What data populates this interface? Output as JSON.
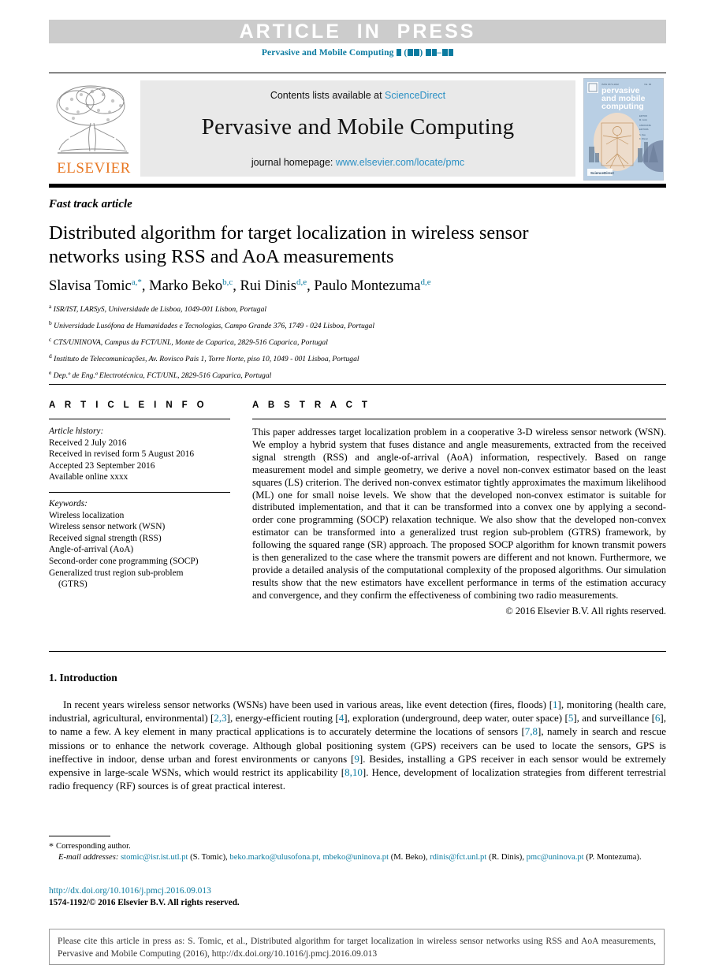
{
  "banner": {
    "article_in_press": "ARTICLE  IN  PRESS",
    "journal_ref_prefix": "Pervasive and Mobile Computing"
  },
  "masthead": {
    "contents_prefix": "Contents lists available at ",
    "sciencedirect": "ScienceDirect",
    "journal_name": "Pervasive and Mobile Computing",
    "homepage_prefix": "journal homepage: ",
    "homepage_url": "www.elsevier.com/locate/pmc",
    "publisher": "ELSEVIER",
    "cover_title_line1": "pervasive",
    "cover_title_line2": "and mobile",
    "cover_title_line3": "computing"
  },
  "article": {
    "type_label": "Fast track article",
    "title": "Distributed algorithm for target localization in wireless sensor networks using RSS and AoA measurements",
    "authors": [
      {
        "name": "Slavisa Tomic",
        "sup": "a,*"
      },
      {
        "name": "Marko Beko",
        "sup": "b,c"
      },
      {
        "name": "Rui Dinis",
        "sup": "d,e"
      },
      {
        "name": "Paulo Montezuma",
        "sup": "d,e"
      }
    ],
    "affiliations": [
      {
        "mark": "a",
        "text": "ISR/IST, LARSyS, Universidade de Lisboa, 1049-001 Lisbon, Portugal"
      },
      {
        "mark": "b",
        "text": "Universidade Lusófona de Humanidades e Tecnologias, Campo Grande 376, 1749 - 024 Lisboa, Portugal"
      },
      {
        "mark": "c",
        "text": "CTS/UNINOVA, Campus da FCT/UNL, Monte de Caparica, 2829-516 Caparica, Portugal"
      },
      {
        "mark": "d",
        "text": "Instituto de Telecomunicações, Av. Rovisco Pais 1, Torre Norte, piso 10, 1049 - 001 Lisboa, Portugal"
      },
      {
        "mark": "e",
        "text": "Dep.º de Eng.ª Electrotécnica, FCT/UNL, 2829-516 Caparica, Portugal"
      }
    ]
  },
  "info": {
    "heading": "A R T I C L E   I N F O",
    "history_label": "Article history:",
    "history": [
      "Received 2 July 2016",
      "Received in revised form 5 August 2016",
      "Accepted 23 September 2016",
      "Available online xxxx"
    ],
    "keywords_label": "Keywords:",
    "keywords": [
      "Wireless localization",
      "Wireless sensor network (WSN)",
      "Received signal strength (RSS)",
      "Angle-of-arrival (AoA)",
      "Second-order cone programming (SOCP)",
      "Generalized trust region sub-problem",
      "(GTRS)"
    ]
  },
  "abstract": {
    "heading": "A B S T R A C T",
    "body": "This paper addresses target localization problem in a cooperative 3-D wireless sensor network (WSN). We employ a hybrid system that fuses distance and angle measurements, extracted from the received signal strength (RSS) and angle-of-arrival (AoA) information, respectively. Based on range measurement model and simple geometry, we derive a novel non-convex estimator based on the least squares (LS) criterion. The derived non-convex estimator tightly approximates the maximum likelihood (ML) one for small noise levels. We show that the developed non-convex estimator is suitable for distributed implementation, and that it can be transformed into a convex one by applying a second-order cone programming (SOCP) relaxation technique. We also show that the developed non-convex estimator can be transformed into a generalized trust region sub-problem (GTRS) framework, by following the squared range (SR) approach. The proposed SOCP algorithm for known transmit powers is then generalized to the case where the transmit powers are different and not known. Furthermore, we provide a detailed analysis of the computational complexity of the proposed algorithms. Our simulation results show that the new estimators have excellent performance in terms of the estimation accuracy and convergence, and they confirm the effectiveness of combining two radio measurements.",
    "copyright": "© 2016 Elsevier B.V. All rights reserved."
  },
  "introduction": {
    "heading": "1. Introduction",
    "paragraph_parts": [
      {
        "t": "In recent years wireless sensor networks (WSNs) have been used in various areas, like event detection (fires, floods) ["
      },
      {
        "r": "1"
      },
      {
        "t": "], monitoring (health care, industrial, agricultural, environmental) ["
      },
      {
        "r": "2,3"
      },
      {
        "t": "], energy-efficient routing ["
      },
      {
        "r": "4"
      },
      {
        "t": "], exploration (underground, deep water, outer space) ["
      },
      {
        "r": "5"
      },
      {
        "t": "], and surveillance ["
      },
      {
        "r": "6"
      },
      {
        "t": "], to name a few. A key element in many practical applications is to accurately determine the locations of sensors ["
      },
      {
        "r": "7,8"
      },
      {
        "t": "], namely in search and rescue missions or to enhance the network coverage. Although global positioning system (GPS) receivers can be used to locate the sensors, GPS is ineffective in indoor, dense urban and forest environments or canyons ["
      },
      {
        "r": "9"
      },
      {
        "t": "]. Besides, installing a GPS receiver in each sensor would be extremely expensive in large-scale WSNs, which would restrict its applicability ["
      },
      {
        "r": "8,10"
      },
      {
        "t": "]. Hence, development of localization strategies from different terrestrial radio frequency (RF) sources is of great practical interest."
      }
    ]
  },
  "footnotes": {
    "corresponding": "Corresponding author.",
    "email_label": "E-mail addresses:",
    "emails": [
      {
        "address": "stomic@isr.ist.utl.pt",
        "who": "(S. Tomic)"
      },
      {
        "address": "beko.marko@ulusofona.pt,",
        "who": ""
      },
      {
        "address": "mbeko@uninova.pt",
        "who": "(M. Beko)"
      },
      {
        "address": "rdinis@fct.unl.pt",
        "who": "(R. Dinis)"
      },
      {
        "address": "pmc@uninova.pt",
        "who": "(P. Montezuma)."
      }
    ],
    "doi": "http://dx.doi.org/10.1016/j.pmcj.2016.09.013",
    "issn_line": "1574-1192/© 2016 Elsevier B.V. All rights reserved."
  },
  "cite_box": {
    "text": "Please cite this article in press as: S. Tomic, et al., Distributed algorithm for target localization in wireless sensor networks using RSS and AoA measurements, Pervasive and Mobile Computing (2016), http://dx.doi.org/10.1016/j.pmcj.2016.09.013"
  },
  "colors": {
    "link": "#0b7ba0",
    "sciencedirect": "#2b90c4",
    "elsevier_orange": "#e87722",
    "banner_grey": "#cccccc"
  }
}
